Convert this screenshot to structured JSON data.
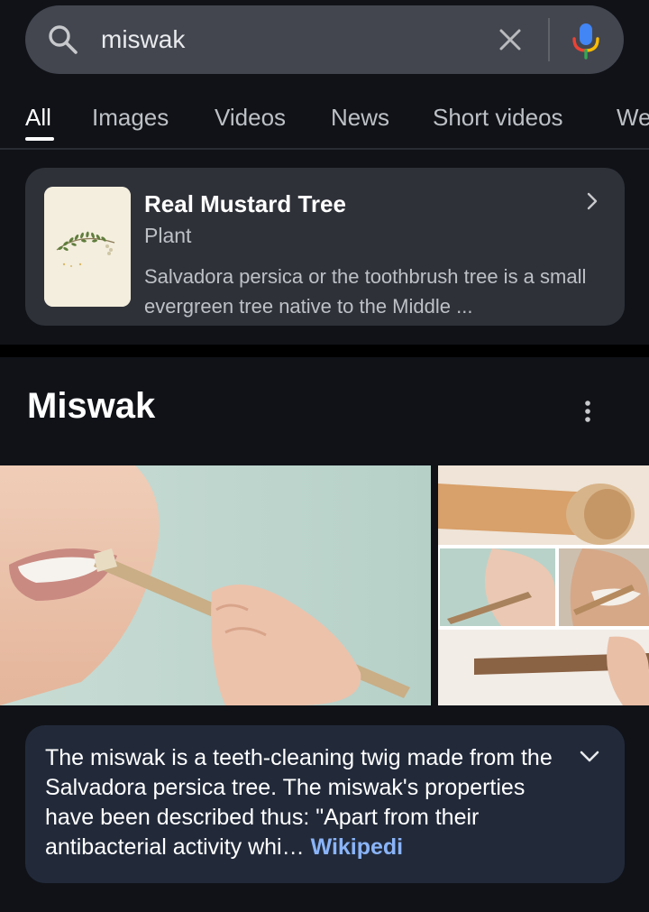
{
  "search": {
    "query": "miswak"
  },
  "tabs": [
    {
      "label": "All",
      "active": true
    },
    {
      "label": "Images"
    },
    {
      "label": "Videos"
    },
    {
      "label": "News"
    },
    {
      "label": "Short videos"
    },
    {
      "label": "We"
    }
  ],
  "knowledge_card": {
    "title": "Real Mustard Tree",
    "subtitle": "Plant",
    "description": "Salvadora persica or the toothbrush tree is a small evergreen tree native to the Middle ..."
  },
  "section": {
    "title": "Miswak"
  },
  "description_card": {
    "text": "The miswak is a teeth-cleaning twig made from the Salvadora persica tree. The miswak's properties have been described thus: \"Apart from their antibacterial activity whi… ",
    "source_link": "Wikipedi"
  },
  "icons": {
    "search": "search-icon",
    "clear": "close-icon",
    "mic": "mic-icon",
    "chevron_right": "chevron-right-icon",
    "more": "more-vert-icon",
    "expand": "chevron-down-icon"
  },
  "colors": {
    "background": "#101218",
    "search_bar": "#43464f",
    "card": "#2f3139",
    "description_card": "#222a3a",
    "link": "#8ab4f8"
  }
}
